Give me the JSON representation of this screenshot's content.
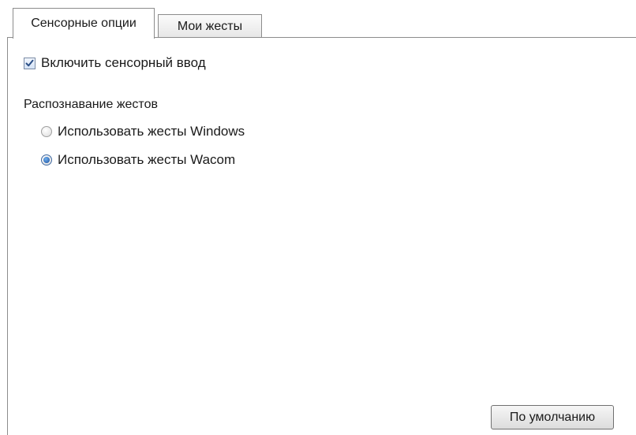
{
  "tabs": [
    {
      "label": "Сенсорные опции",
      "active": true
    },
    {
      "label": "Мои жесты",
      "active": false
    }
  ],
  "touch": {
    "enable_label": "Включить сенсорный ввод",
    "enable_checked": true
  },
  "gestures": {
    "section_label": "Распознавание жестов",
    "options": [
      {
        "label": "Использовать жесты Windows",
        "selected": false
      },
      {
        "label": "Использовать жесты Wacom",
        "selected": true
      }
    ]
  },
  "footer": {
    "default_button_label": "По умолчанию"
  },
  "colors": {
    "accent": "#1c4f9c",
    "check_mark": "#2b4f86"
  }
}
